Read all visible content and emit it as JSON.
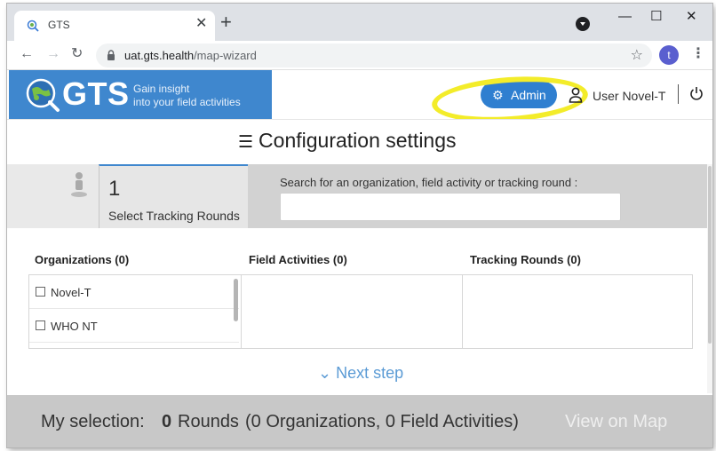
{
  "browser": {
    "tab_title": "GTS",
    "tab_close": "✕",
    "new_tab": "+",
    "window_controls": {
      "minimize": "—",
      "maximize": "☐",
      "close": "✕"
    },
    "url_host": "uat.gts.health",
    "url_path": "/map-wizard",
    "profile_initial": "t",
    "icons": [
      "back-arrow-icon",
      "forward-arrow-icon",
      "reload-icon",
      "lock-icon",
      "star-icon",
      "kebab-menu-icon"
    ]
  },
  "header": {
    "brand_name": "GTS",
    "tagline_line1": "Gain insight",
    "tagline_line2": "into your field activities",
    "admin_label": "Admin",
    "user_label": "User Novel-T",
    "colors": {
      "brand": "#3f87ce",
      "admin_button": "#2f7fd0",
      "highlight": "#f3ec2a"
    }
  },
  "config": {
    "title": "Configuration settings",
    "step_number": "1",
    "step_label": "Select Tracking Rounds",
    "search_label": "Search for an organization, field activity or tracking round :",
    "search_value": ""
  },
  "columns": {
    "organizations_header": "Organizations (0)",
    "field_activities_header": "Field Activities (0)",
    "tracking_rounds_header": "Tracking Rounds (0)",
    "organizations": [
      {
        "label": "Novel-T",
        "checked": false
      },
      {
        "label": "WHO NT",
        "checked": false
      }
    ]
  },
  "next_step_label": "Next step",
  "selection": {
    "label": "My selection:",
    "count": "0",
    "rounds_label": "Rounds",
    "detail": "(0 Organizations, 0 Field Activities)",
    "view_on_map": "View on Map"
  }
}
